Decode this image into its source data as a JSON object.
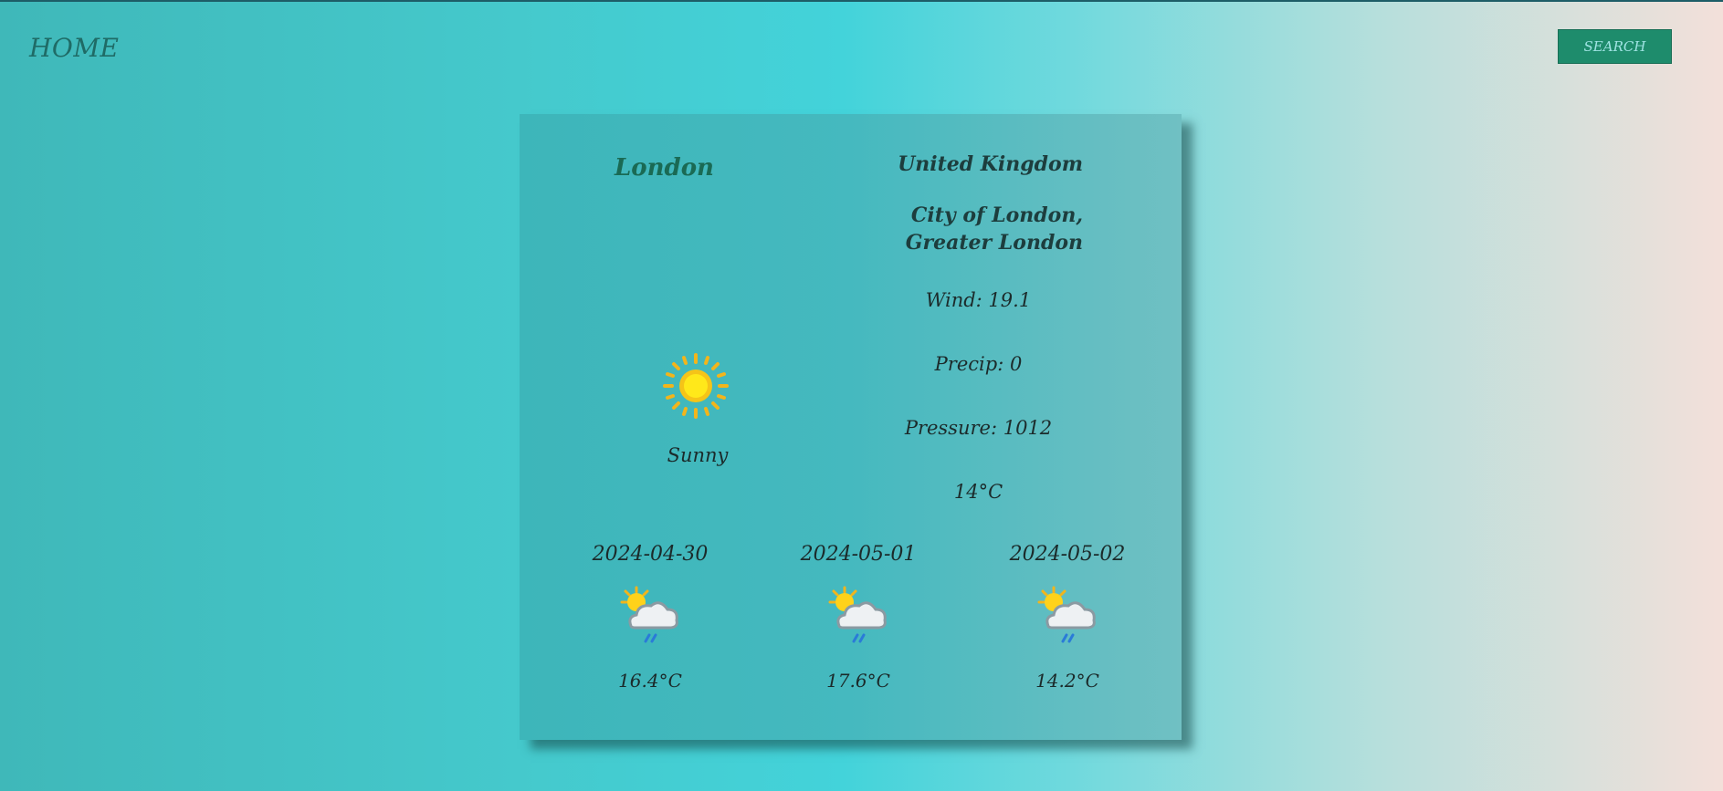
{
  "nav": {
    "home_label": "HOME",
    "search_label": "SEARCH"
  },
  "location": {
    "city": "London",
    "country": "United Kingdom",
    "region": "City of London, Greater London"
  },
  "current": {
    "condition": "Sunny",
    "condition_icon": "sun-icon",
    "wind": "Wind: 19.1",
    "precip": "Precip: 0",
    "pressure": "Pressure: 1012",
    "temperature": "14°C"
  },
  "forecast": [
    {
      "date": "2024-04-30",
      "icon": "partly-cloudy-rain-icon",
      "temp": "16.4°C"
    },
    {
      "date": "2024-05-01",
      "icon": "partly-cloudy-rain-icon",
      "temp": "17.6°C"
    },
    {
      "date": "2024-05-02",
      "icon": "partly-cloudy-rain-icon",
      "temp": "14.2°C"
    }
  ],
  "colors": {
    "accent": "#1e8c6c",
    "card_bg": "#45b9bf",
    "city_text": "#1a6a54"
  }
}
